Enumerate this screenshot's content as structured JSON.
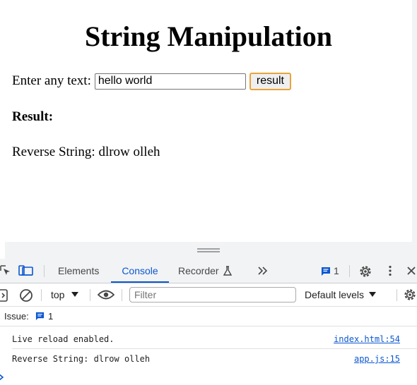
{
  "page": {
    "title": "String Manipulation",
    "input_label": "Enter any text:",
    "input_value": "hello world",
    "button_label": "result",
    "result_heading": "Result:",
    "reverse_label": "Reverse String:",
    "reverse_value": "dlrow olleh"
  },
  "devtools": {
    "tabs": [
      "Elements",
      "Console",
      "Recorder"
    ],
    "active_tab": "Console",
    "message_count": "1",
    "context": "top",
    "filter_placeholder": "Filter",
    "levels": "Default levels",
    "issues_label": "Issue:",
    "issues_count": "1",
    "accent_color": "#0b57d0",
    "logs": [
      {
        "message": "Live reload enabled.",
        "source": "index.html:54"
      },
      {
        "message": "Reverse String: dlrow olleh",
        "source": "app.js:15"
      }
    ]
  }
}
